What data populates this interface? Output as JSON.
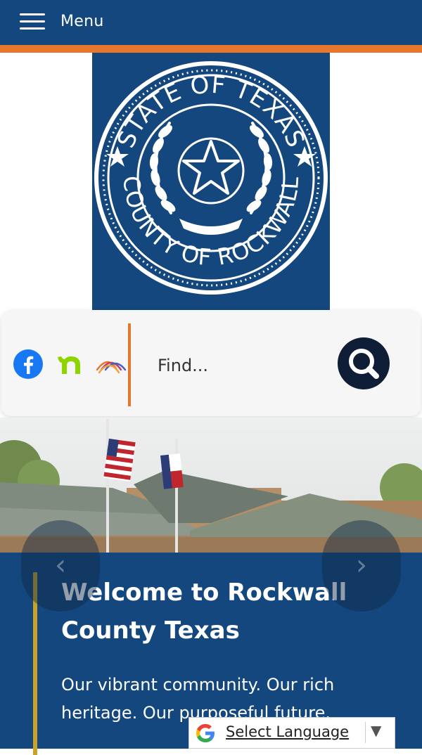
{
  "header": {
    "menu_label": "Menu",
    "colors": {
      "primary": "#13477d",
      "accent": "#e8772e"
    }
  },
  "seal": {
    "top_text": "STATE OF TEXAS",
    "bottom_text": "COUNTY OF ROCKWALL"
  },
  "search": {
    "placeholder": "Find...",
    "social_icons": [
      "facebook-icon",
      "nextdoor-icon",
      "arc-logo-icon"
    ],
    "button_icon": "search-icon"
  },
  "hero": {
    "title": "Welcome to Rockwall County Texas",
    "text": "Our vibrant community. Our rich heritage. Our purposeful future.",
    "prev_icon": "‹",
    "next_icon": "›",
    "accent_color": "#c9a227"
  },
  "translate": {
    "label": "Select Language",
    "arrow": "▼"
  }
}
